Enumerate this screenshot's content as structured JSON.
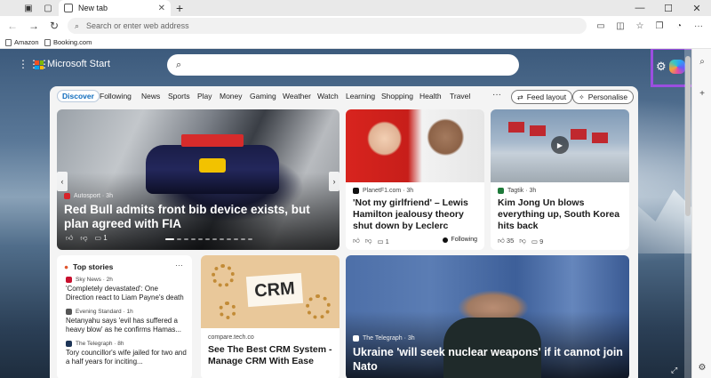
{
  "browser": {
    "tab_title": "New tab",
    "address_placeholder": "Search or enter web address",
    "bookmarks": [
      "Amazon",
      "Booking.com"
    ]
  },
  "msstart": {
    "brand": "Microsoft Start",
    "logo_colors": [
      "#f25022",
      "#7fba00",
      "#00a4ef",
      "#ffb900"
    ],
    "highlight_color": "#9b4ee0"
  },
  "feed_nav": {
    "tabs": [
      "Discover",
      "Following",
      "News",
      "Sports",
      "Play",
      "Money",
      "Gaming",
      "Weather",
      "Watch",
      "Learning",
      "Shopping",
      "Health",
      "Travel"
    ],
    "more": "···",
    "feed_layout": "Feed layout",
    "personalise": "Personalise"
  },
  "hero": {
    "source": "Autosport · 3h",
    "title": "Red Bull admits front bib device exists, but plan agreed with FIA",
    "comments": "1"
  },
  "cards": [
    {
      "source": "PlanetF1.com · 3h",
      "title": "'Not my girlfriend' – Lewis Hamilton jealousy theory shut down by Leclerc",
      "comments": "1",
      "following": "Following"
    },
    {
      "source": "Tagtik · 3h",
      "title": "Kim Jong Un blows everything up, South Korea hits back",
      "likes": "35",
      "comments": "9"
    }
  ],
  "top_stories": {
    "heading": "Top stories",
    "items": [
      {
        "source": "Sky News · 2h",
        "title": "'Completely devastated': One Direction react to Liam Payne's death"
      },
      {
        "source": "Evening Standard · 1h",
        "title": "Netanyahu says 'evil has suffered a heavy blow' as he confirms Hamas..."
      },
      {
        "source": "The Telegraph · 8h",
        "title": "Tory councillor's wife jailed for two and a half years for inciting..."
      }
    ]
  },
  "crm": {
    "source": "compare.tech.co",
    "image_text": "CRM",
    "title": "See The Best CRM System - Manage CRM With Ease"
  },
  "feature": {
    "source": "The Telegraph · 3h",
    "title": "Ukraine 'will seek nuclear weapons' if it cannot join Nato"
  }
}
